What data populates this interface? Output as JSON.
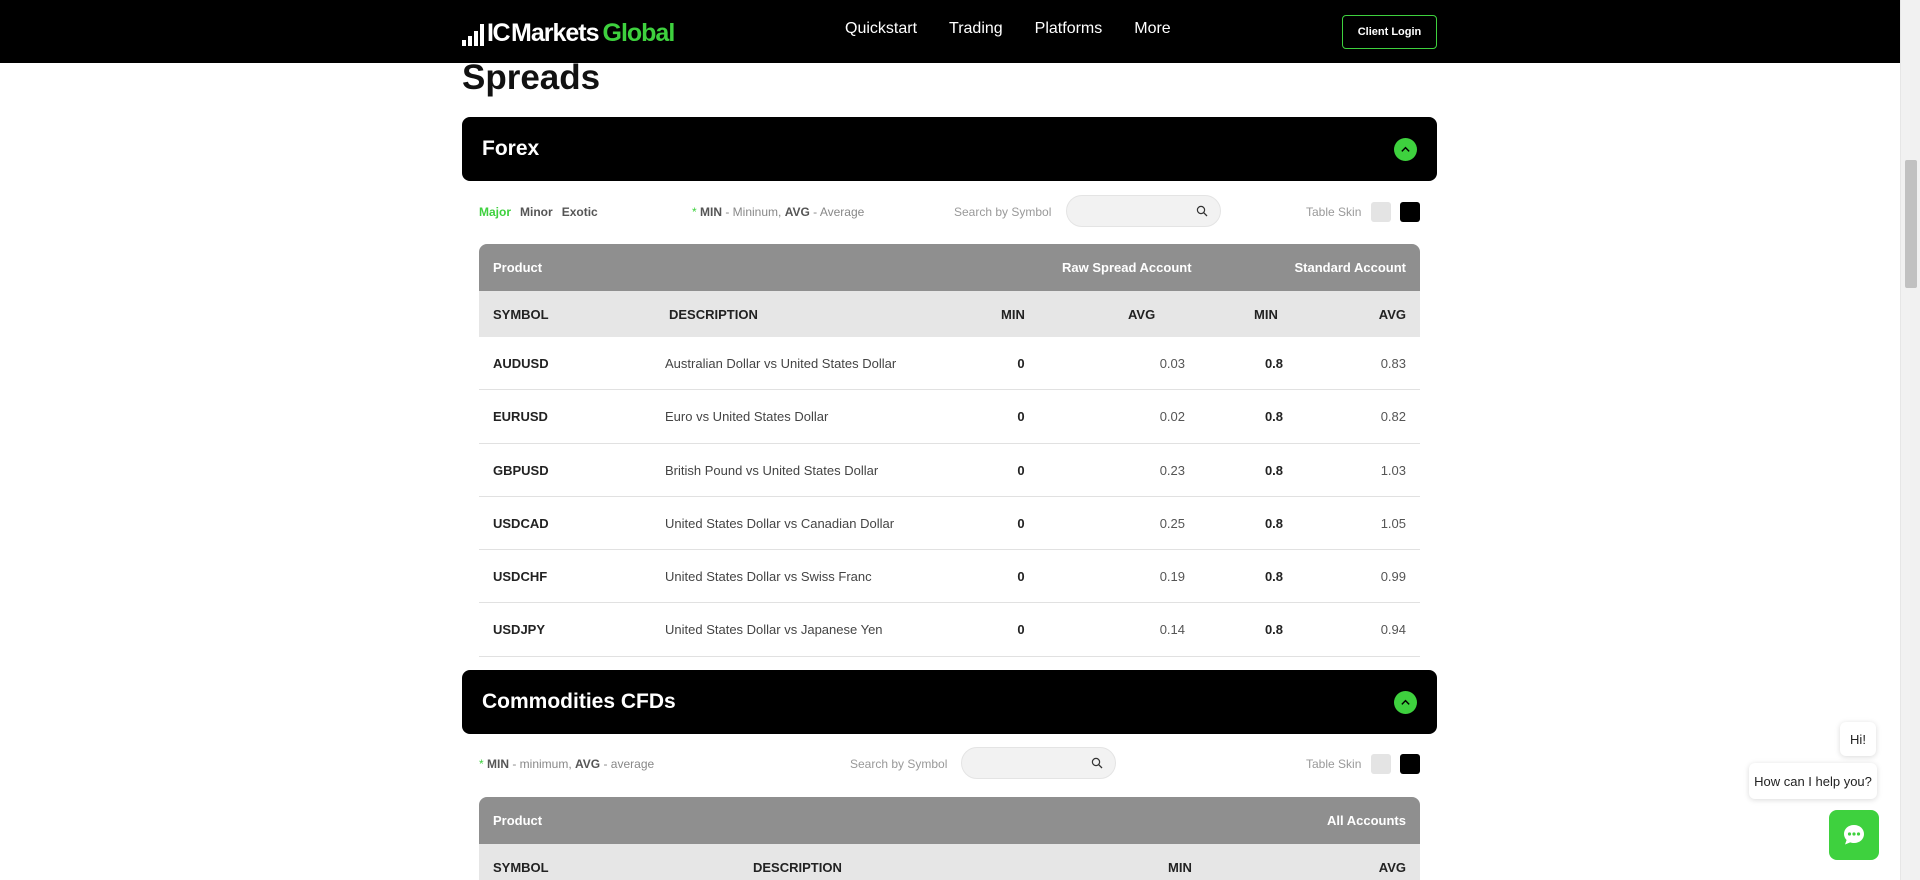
{
  "header": {
    "logo": {
      "ic": "IC",
      "markets": "Markets",
      "global": "Global"
    },
    "nav": [
      "Quickstart",
      "Trading",
      "Platforms",
      "More"
    ],
    "login_label": "Client Login"
  },
  "page_title": "Spreads",
  "forex": {
    "title": "Forex",
    "tabs": {
      "major": "Major",
      "minor": "Minor",
      "exotic": "Exotic"
    },
    "legend": {
      "asterisk": "*",
      "min": "MIN",
      "min_desc": " - Mininum, ",
      "avg": "AVG",
      "avg_desc": " - Average"
    },
    "search_label": "Search by Symbol",
    "search_value": "",
    "skin_label": "Table Skin",
    "group_headers": {
      "product": "Product",
      "raw": "Raw Spread Account",
      "standard": "Standard Account"
    },
    "columns": {
      "symbol": "SYMBOL",
      "description": "DESCRIPTION",
      "raw_min": "MIN",
      "raw_avg": "AVG",
      "std_min": "MIN",
      "std_avg": "AVG"
    },
    "rows": [
      {
        "symbol": "AUDUSD",
        "description": "Australian Dollar vs United States Dollar",
        "raw_min": "0",
        "raw_avg": "0.03",
        "std_min": "0.8",
        "std_avg": "0.83"
      },
      {
        "symbol": "EURUSD",
        "description": "Euro vs United States Dollar",
        "raw_min": "0",
        "raw_avg": "0.02",
        "std_min": "0.8",
        "std_avg": "0.82"
      },
      {
        "symbol": "GBPUSD",
        "description": "British Pound vs United States Dollar",
        "raw_min": "0",
        "raw_avg": "0.23",
        "std_min": "0.8",
        "std_avg": "1.03"
      },
      {
        "symbol": "USDCAD",
        "description": "United States Dollar vs Canadian Dollar",
        "raw_min": "0",
        "raw_avg": "0.25",
        "std_min": "0.8",
        "std_avg": "1.05"
      },
      {
        "symbol": "USDCHF",
        "description": "United States Dollar vs Swiss Franc",
        "raw_min": "0",
        "raw_avg": "0.19",
        "std_min": "0.8",
        "std_avg": "0.99"
      },
      {
        "symbol": "USDJPY",
        "description": "United States Dollar vs Japanese Yen",
        "raw_min": "0",
        "raw_avg": "0.14",
        "std_min": "0.8",
        "std_avg": "0.94"
      }
    ]
  },
  "commodities": {
    "title": "Commodities CFDs",
    "legend": {
      "asterisk": "*",
      "min": "MIN",
      "min_desc": " - minimum, ",
      "avg": "AVG",
      "avg_desc": " - average"
    },
    "search_label": "Search by Symbol",
    "search_value": "",
    "skin_label": "Table Skin",
    "group_headers": {
      "product": "Product",
      "all": "All Accounts"
    },
    "columns": {
      "symbol": "SYMBOL",
      "description": "DESCRIPTION",
      "min": "MIN",
      "avg": "AVG"
    }
  },
  "chat": {
    "greeting": "Hi!",
    "prompt": "How can I help you?"
  },
  "colors": {
    "accent": "#3ed13e",
    "header_bg": "#000000",
    "table_head": "#8f8f8f",
    "table_subhead": "#e6e6e6"
  },
  "icons": {
    "toggle": "chevron-up-icon",
    "search": "search-icon",
    "chat": "chat-icon"
  }
}
